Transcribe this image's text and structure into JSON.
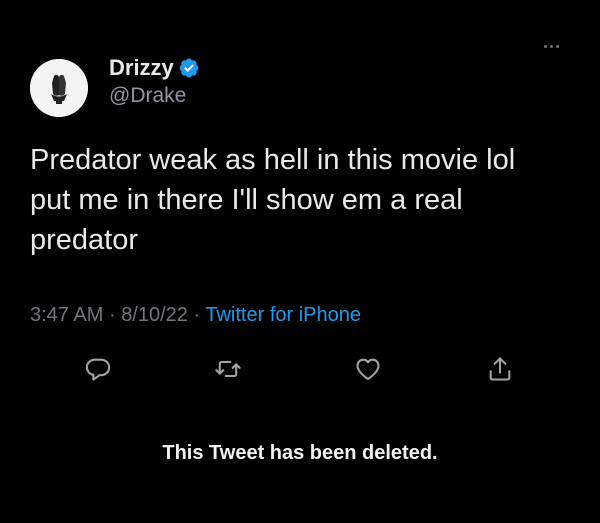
{
  "tweet": {
    "display_name": "Drizzy",
    "handle": "@Drake",
    "verified": true,
    "text_lines": [
      "Predator weak as hell in this movie lol",
      "put me in there I'll show em a real",
      "predator"
    ],
    "time": "3:47 AM",
    "separator": "·",
    "date": "8/10/22",
    "source": "Twitter for iPhone"
  },
  "actions": [
    {
      "name": "reply",
      "icon": "reply-icon"
    },
    {
      "name": "retweet",
      "icon": "retweet-icon"
    },
    {
      "name": "like",
      "icon": "heart-icon"
    },
    {
      "name": "share",
      "icon": "share-icon"
    }
  ],
  "notice": "This Tweet has been deleted.",
  "colors": {
    "background": "#000000",
    "text": "#e7e9ea",
    "muted": "#71767b",
    "accent": "#1d9bf0"
  }
}
